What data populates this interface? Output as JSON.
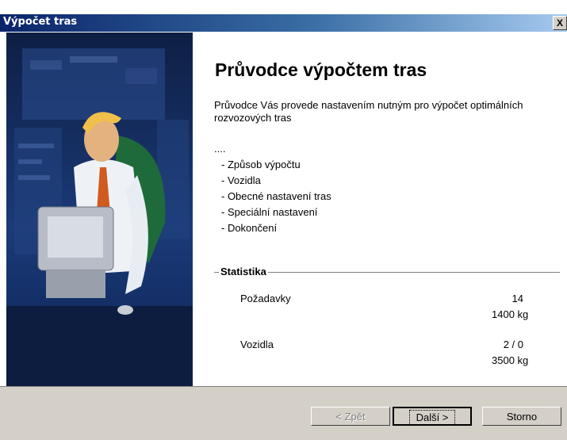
{
  "window": {
    "title": "Výpočet tras",
    "close_label": "X"
  },
  "wizard": {
    "heading": "Průvodce výpočtem tras",
    "intro": "Průvodce Vás provede nastavením nutným pro výpočet optimálních rozvozových tras",
    "dots": "....",
    "steps": [
      {
        "label": "- Způsob výpočtu"
      },
      {
        "label": "- Vozidla"
      },
      {
        "label": "- Obecné nastavení tras"
      },
      {
        "label": "- Speciální nastavení"
      },
      {
        "label": "- Dokončení"
      }
    ]
  },
  "statistics": {
    "title": "Statistika",
    "rows": [
      {
        "name": "Požadavky",
        "value1": "14",
        "value2": "1400  kg"
      },
      {
        "name": "Vozidla",
        "value1": "2 / 0",
        "value2": "3500  kg"
      }
    ]
  },
  "buttons": {
    "back": "< Zpět",
    "next": "Další >",
    "cancel": "Storno"
  },
  "colors": {
    "titlebar_start": "#0a246a",
    "titlebar_end": "#a6caf0",
    "illustration_bg": "#1b3a78",
    "dialog_bg": "#d4d0c8"
  },
  "icons": {
    "illustration": "man-at-computer-illustration"
  }
}
